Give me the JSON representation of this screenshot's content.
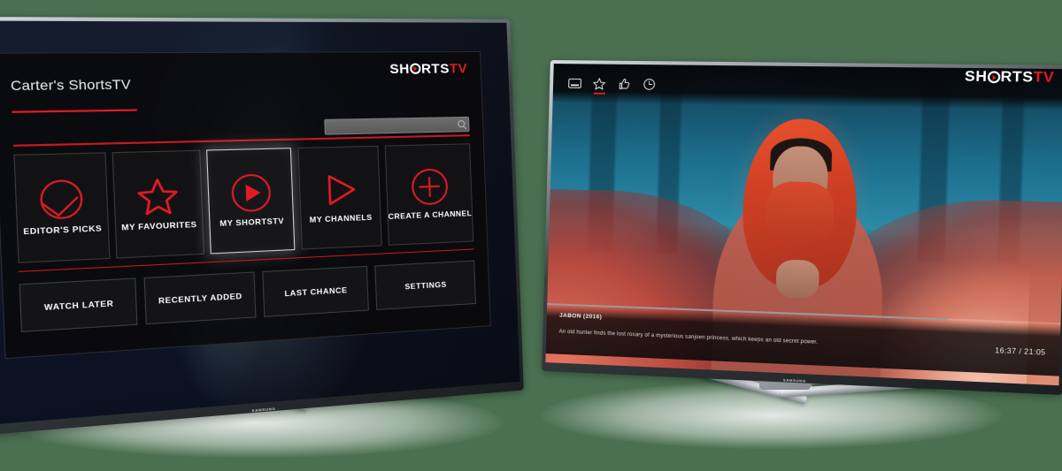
{
  "scene": {
    "background_color": "#4a7051",
    "device_brand": "SAMSUNG",
    "accent_color": "#e01b24"
  },
  "left_tv": {
    "device_label": "SAMSUNG",
    "app_brand": {
      "word": "SHORTS",
      "suffix": "TV",
      "letter_s1": "SH",
      "letter_s2": "RTS"
    },
    "profile_title": "Carter's ShortsTV",
    "search": {
      "value": "",
      "placeholder": "",
      "icon": "search-icon"
    },
    "tiles": [
      {
        "label": "EDITOR'S PICKS",
        "icon": "check-circle-icon",
        "selected": false
      },
      {
        "label": "MY FAVOURITES",
        "icon": "star-icon",
        "selected": false
      },
      {
        "label": "MY SHORTSTV",
        "icon": "play-circle-icon",
        "selected": true
      },
      {
        "label": "MY CHANNELS",
        "icon": "play-triangle-icon",
        "selected": false
      },
      {
        "label": "CREATE A CHANNEL",
        "icon": "plus-circle-icon",
        "selected": false
      }
    ],
    "buttons": [
      {
        "label": "WATCH LATER"
      },
      {
        "label": "RECENTLY ADDED"
      },
      {
        "label": "LAST CHANCE"
      },
      {
        "label": "SETTINGS"
      }
    ]
  },
  "right_tv": {
    "device_label": "SAMSUNG",
    "app_brand": {
      "word": "SHORTS",
      "suffix": "TV",
      "letter_s1": "SH",
      "letter_s2": "RTS"
    },
    "toolbar": [
      {
        "icon": "subtitles-icon",
        "active": false
      },
      {
        "icon": "star-icon",
        "active": true
      },
      {
        "icon": "thumbs-up-icon",
        "active": false
      },
      {
        "icon": "clock-icon",
        "active": false
      }
    ],
    "now_playing": {
      "title": "JABON (2016)",
      "description": "An old hunter finds the lost rosary of a mysterious sanjoen princess, which keeps an old secret power.",
      "elapsed": "16:37",
      "duration": "21:05",
      "time_display": "16:37 / 21:05",
      "progress_percent": 79
    }
  }
}
